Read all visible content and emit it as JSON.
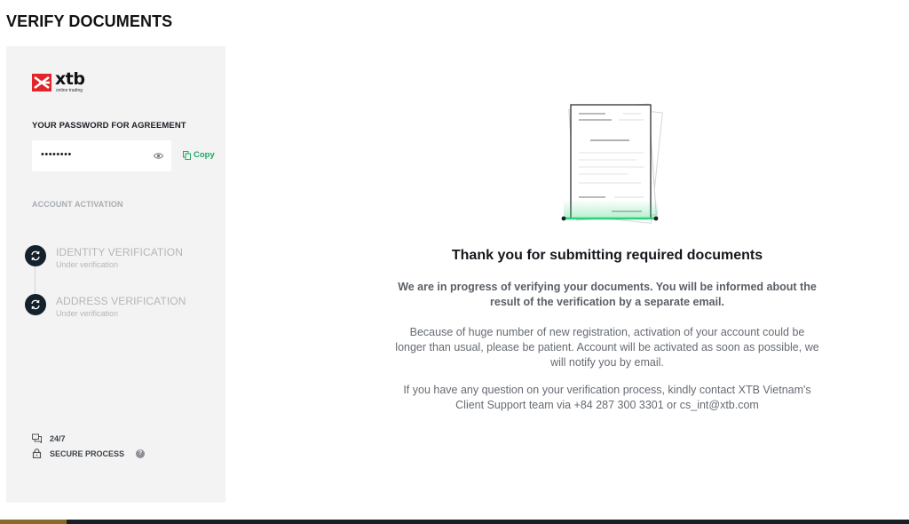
{
  "page": {
    "title": "VERIFY DOCUMENTS"
  },
  "sidebar": {
    "logo": {
      "word": "xtb",
      "tagline": "online trading"
    },
    "password_label": "YOUR PASSWORD FOR AGREEMENT",
    "password_value": "••••••••",
    "copy_label": "Copy",
    "activation_label": "ACCOUNT ACTIVATION",
    "steps": [
      {
        "title": "IDENTITY VERIFICATION",
        "status": "Under verification",
        "icon": "refresh-icon"
      },
      {
        "title": "ADDRESS VERIFICATION",
        "status": "Under verification",
        "icon": "refresh-icon"
      }
    ],
    "features": [
      {
        "label": "24/7",
        "icon": "chat-icon"
      },
      {
        "label": "SECURE PROCESS",
        "icon": "lock-icon"
      }
    ]
  },
  "main": {
    "title": "Thank you for submitting required documents",
    "bold_text": "We are in progress of verifying your documents. You will be informed about the result of the verification by a separate email.",
    "paragraph1": "Because of huge number of new registration, activation of your account could be longer than usual, please be patient. Account will be activated as soon as possible, we will notify you by email.",
    "paragraph2": "If you have any question on your verification process, kindly contact XTB Vietnam's Client Support team via +84 287 300 3301 or cs_int@xtb.com"
  },
  "colors": {
    "accent_green": "#1ea864",
    "brand_red": "#e0262b",
    "step_icon_bg": "#14202b",
    "sidebar_bg": "#f3f3f3"
  }
}
